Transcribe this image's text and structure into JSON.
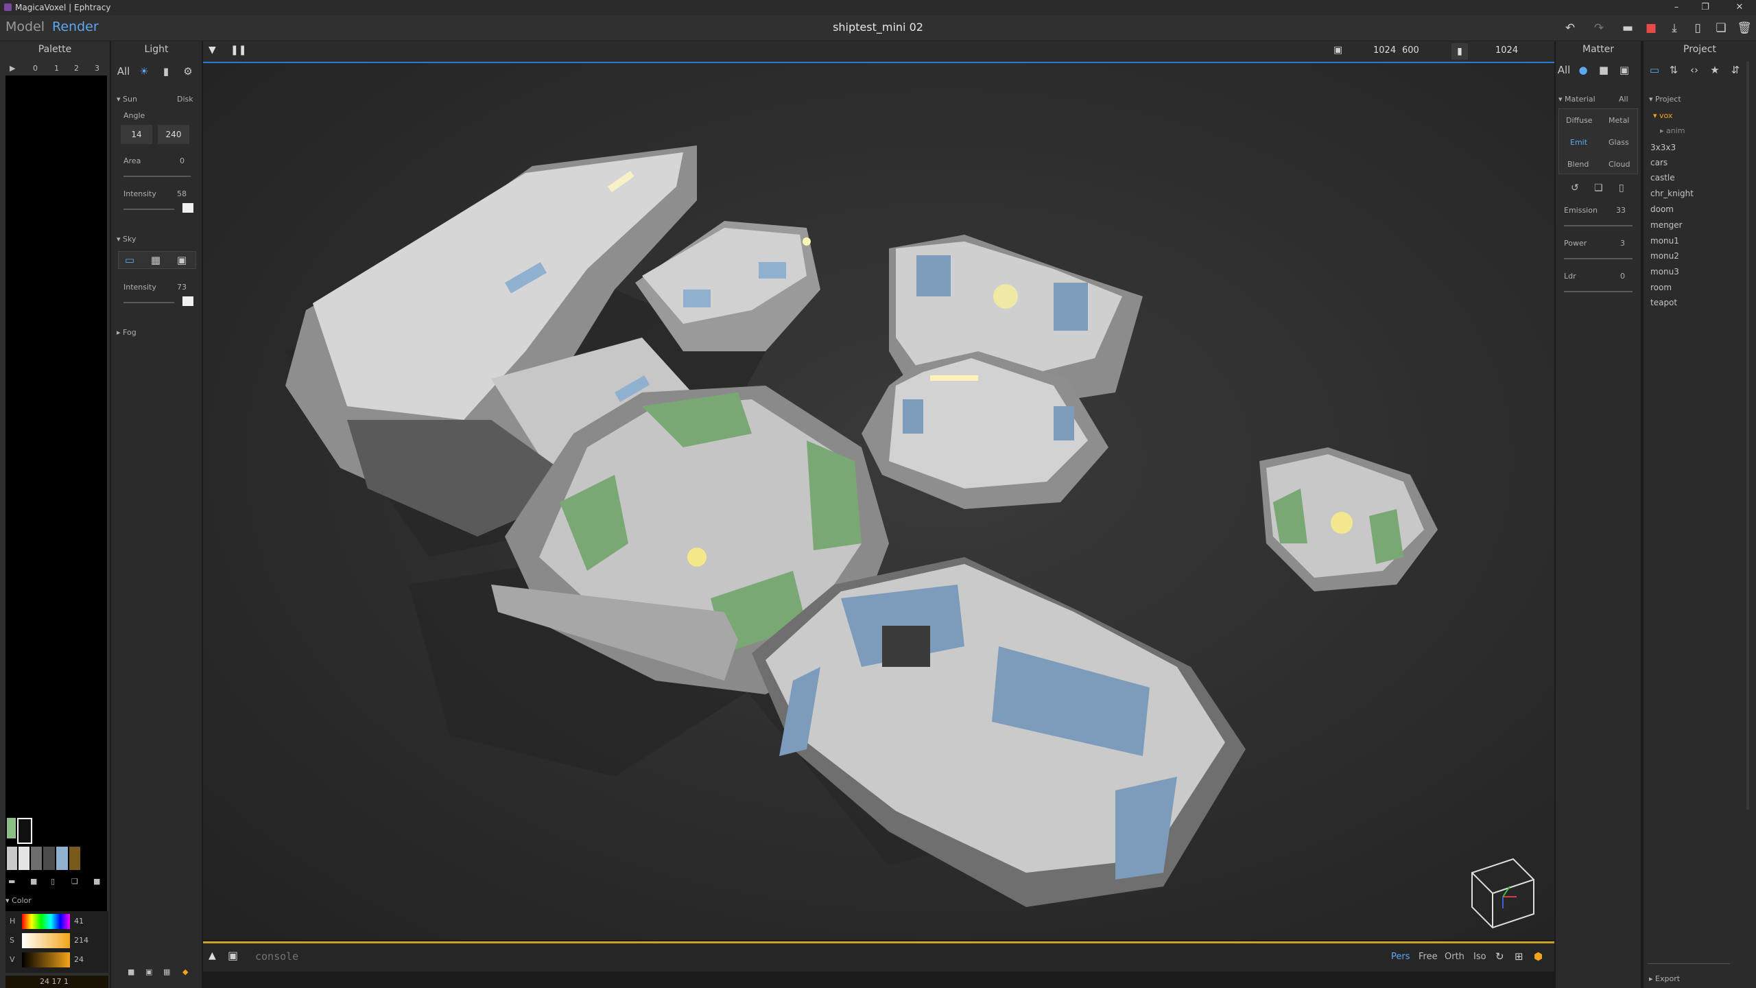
{
  "app": {
    "title": "MagicaVoxel | Ephtracy",
    "doc_name": "shiptest_mini 02"
  },
  "modes": {
    "model": "Model",
    "render": "Render"
  },
  "palette": {
    "header": "Palette",
    "pages": [
      "0",
      "1",
      "2",
      "3"
    ],
    "swatches": [
      "#8bbf85",
      "#1a1a1a",
      "#c9c9c9",
      "#8a8a8a",
      "#5a5a5a",
      "#8fb0cf",
      "#b98b2a"
    ]
  },
  "color": {
    "header": "Color",
    "h_label": "H",
    "h_value": "41",
    "s_label": "S",
    "s_value": "214",
    "v_label": "V",
    "v_value": "24",
    "rgb": "24 17 1"
  },
  "light": {
    "header": "Light",
    "tabs": {
      "all": "All"
    },
    "sun": {
      "label": "Sun",
      "disk": "Disk",
      "angle_label": "Angle",
      "angle_a": "14",
      "angle_b": "240",
      "area_label": "Area",
      "area_value": "0",
      "intensity_label": "Intensity",
      "intensity_value": "58"
    },
    "sky": {
      "label": "Sky",
      "intensity_label": "Intensity",
      "intensity_value": "73"
    },
    "fog": {
      "label": "Fog"
    }
  },
  "viewport": {
    "width": "1024",
    "height": "600",
    "samples": "1024",
    "camera_modes": [
      "Pers",
      "Free",
      "Orth",
      "Iso"
    ],
    "active_camera": "Pers",
    "console_placeholder": "console"
  },
  "matter": {
    "header": "Matter",
    "tabs": {
      "all": "All"
    },
    "material_label": "Material",
    "material_all": "All",
    "types": [
      "Diffuse",
      "Metal",
      "Emit",
      "Glass",
      "Blend",
      "Cloud"
    ],
    "selected_type": "Emit",
    "emission_label": "Emission",
    "emission_value": "33",
    "power_label": "Power",
    "power_value": "3",
    "ldr_label": "Ldr",
    "ldr_value": "0"
  },
  "project": {
    "header": "Project",
    "section": "Project",
    "folder": "vox",
    "subfolder": "anim",
    "items": [
      "3x3x3",
      "cars",
      "castle",
      "chr_knight",
      "doom",
      "menger",
      "monu1",
      "monu2",
      "monu3",
      "room",
      "teapot"
    ],
    "export": "Export"
  },
  "accent": "#2a7bd6",
  "highlight": "#c9a227"
}
